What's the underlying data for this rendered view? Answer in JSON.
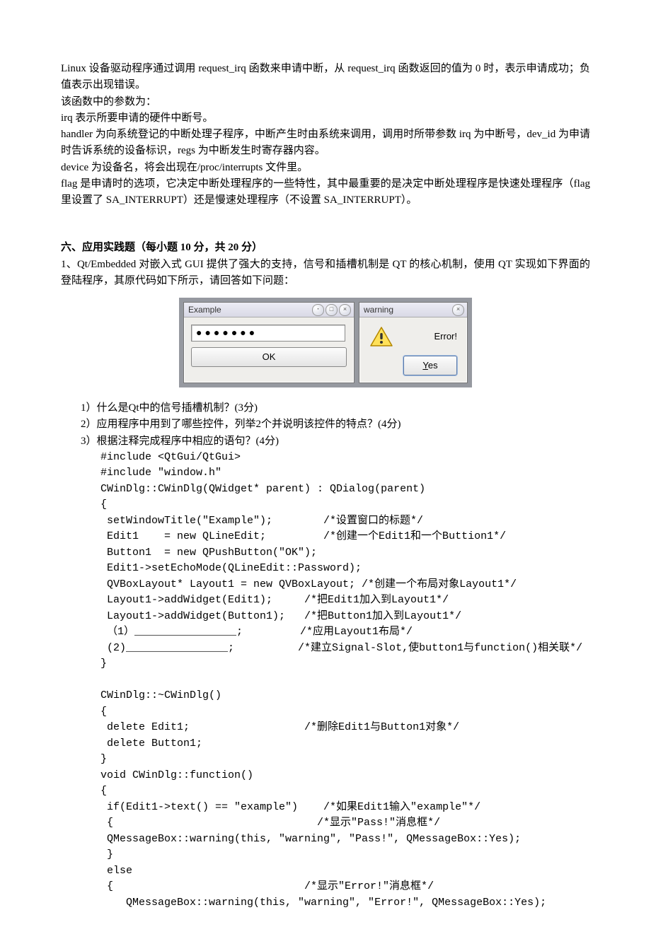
{
  "intro": {
    "p1": "Linux 设备驱动程序通过调用 request_irq 函数来申请中断，从 request_irq 函数返回的值为 0 时，表示申请成功；负值表示出现错误。",
    "p2": "该函数中的参数为：",
    "p3": "irq 表示所要申请的硬件中断号。",
    "p4": "handler 为向系统登记的中断处理子程序，中断产生时由系统来调用，调用时所带参数 irq 为中断号，dev_id 为申请时告诉系统的设备标识，regs 为中断发生时寄存器内容。",
    "p5": "device 为设备名，将会出现在/proc/interrupts 文件里。",
    "p6": "flag 是申请时的选项，它决定中断处理程序的一些特性，其中最重要的是决定中断处理程序是快速处理程序（flag 里设置了 SA_INTERRUPT）还是慢速处理程序（不设置 SA_INTERRUPT）。"
  },
  "section6": {
    "title": "六、应用实践题（每小题 10 分，共 20 分）",
    "q1_intro": "1、Qt/Embedded 对嵌入式 GUI 提供了强大的支持，信号和插槽机制是 QT 的核心机制，使用 QT 实现如下界面的登陆程序，其原代码如下所示，请回答如下问题："
  },
  "windows": {
    "example": {
      "title": "Example",
      "password_mask": "●●●●●●●",
      "ok_label": "OK"
    },
    "warning": {
      "title": "warning",
      "message": "Error!",
      "yes_label": "Yes",
      "yes_accel": "Y"
    }
  },
  "subq": {
    "a": "1）什么是Qt中的信号插槽机制？(3分)",
    "b": "2）应用程序中用到了哪些控件，列举2个并说明该控件的特点？(4分)",
    "c": "3）根据注释完成程序中相应的语句？(4分)"
  },
  "code": "#include <QtGui/QtGui>\n#include \"window.h\"\nCWinDlg::CWinDlg(QWidget* parent) : QDialog(parent)\n{\n setWindowTitle(\"Example\");        /*设置窗口的标题*/\n Edit1    = new QLineEdit;         /*创建一个Edit1和一个Buttion1*/\n Button1  = new QPushButton(\"OK\");\n Edit1->setEchoMode(QLineEdit::Password);\n QVBoxLayout* Layout1 = new QVBoxLayout; /*创建一个布局对象Layout1*/\n Layout1->addWidget(Edit1);     /*把Edit1加入到Layout1*/\n Layout1->addWidget(Button1);   /*把Button1加入到Layout1*/\n （1）________________;         /*应用Layout1布局*/\n (2)________________;          /*建立Signal-Slot,使button1与function()相关联*/\n}\n\nCWinDlg::~CWinDlg()\n{\n delete Edit1;                  /*删除Edit1与Button1对象*/\n delete Button1;\n}\nvoid CWinDlg::function()\n{\n if(Edit1->text() == \"example\")    /*如果Edit1输入\"example\"*/\n {                                /*显示\"Pass!\"消息框*/\n QMessageBox::warning(this, \"warning\", \"Pass!\", QMessageBox::Yes);\n }\n else\n {                              /*显示\"Error!\"消息框*/\n    QMessageBox::warning(this, \"warning\", \"Error!\", QMessageBox::Yes);"
}
